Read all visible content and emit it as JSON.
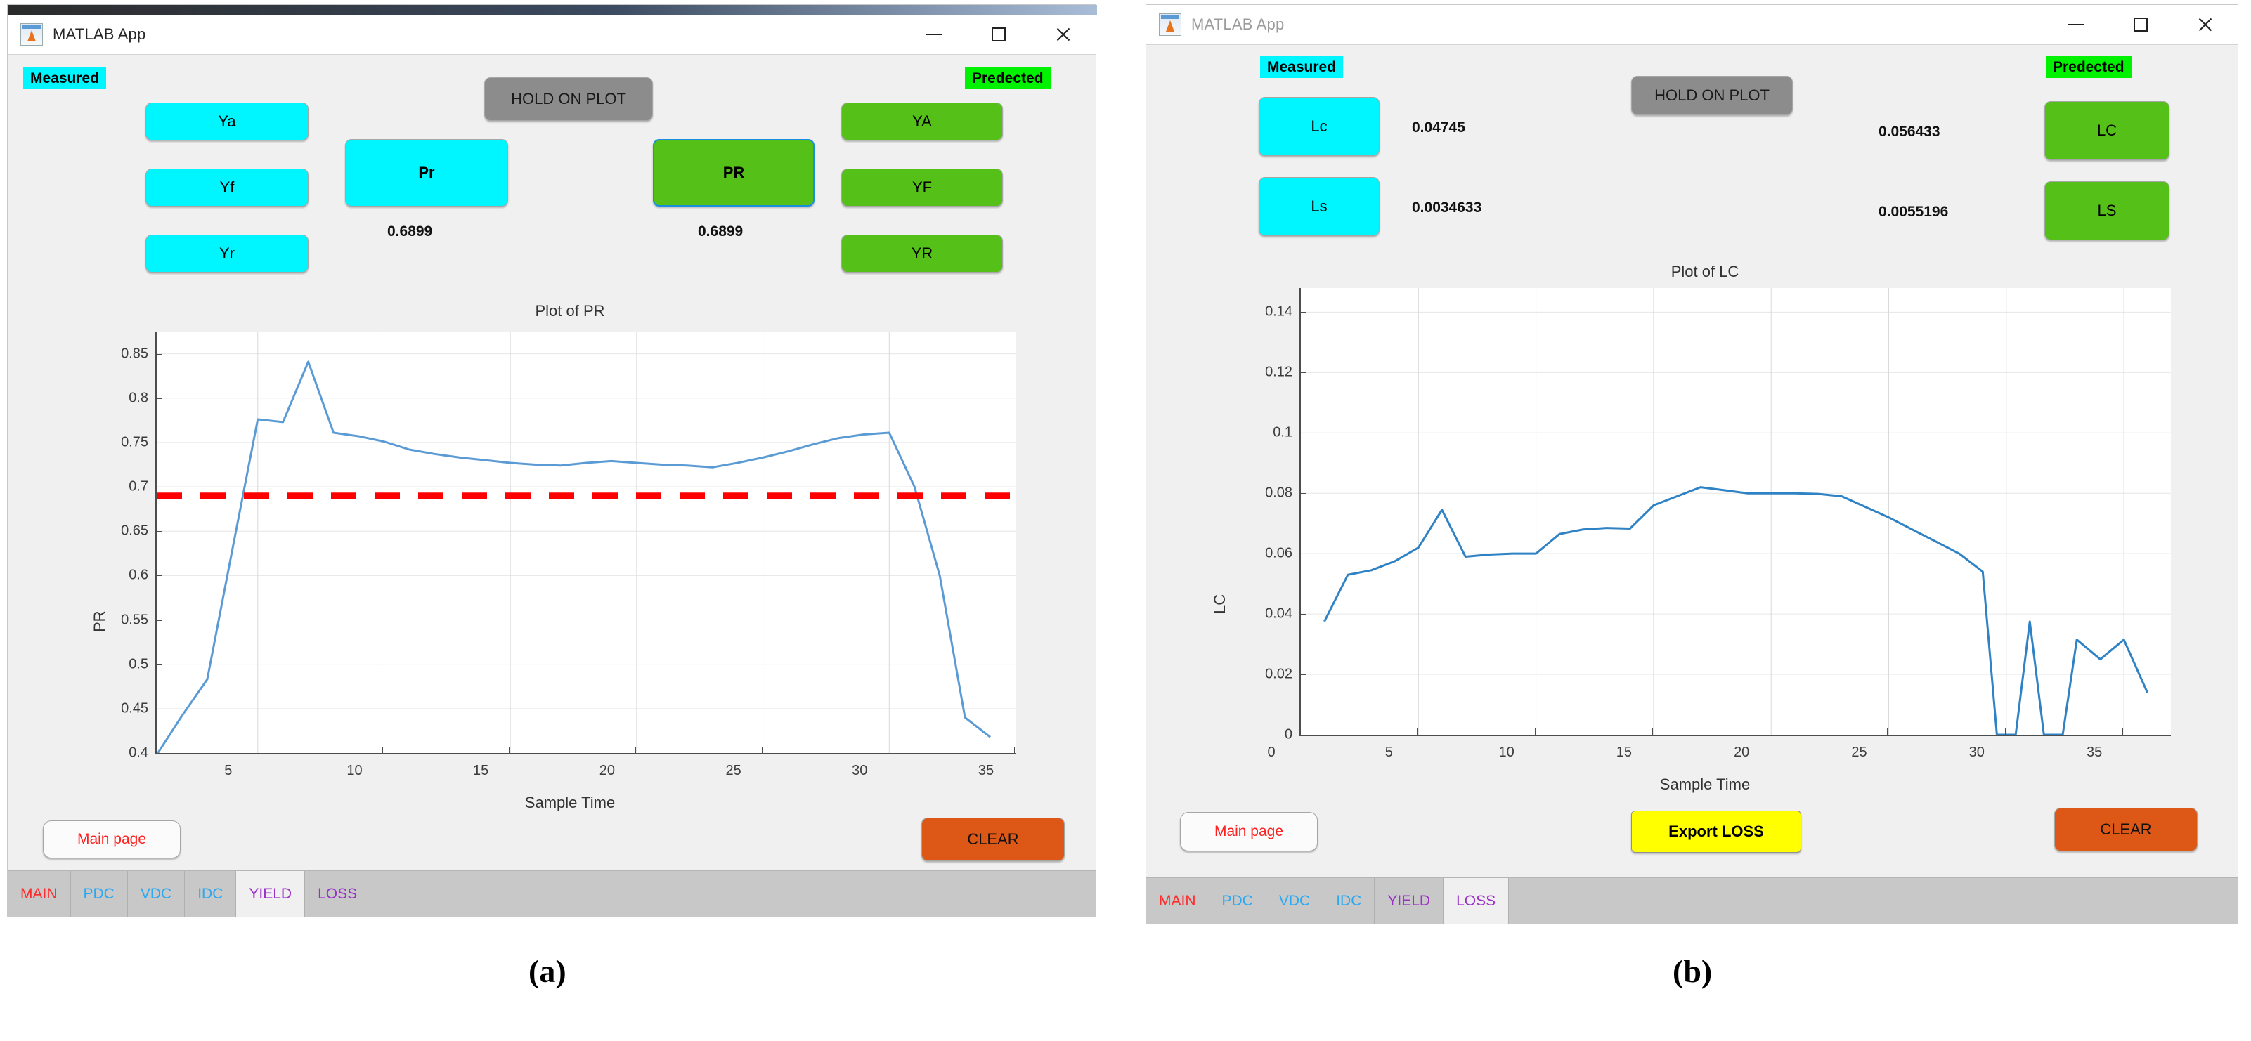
{
  "panel_a": {
    "window": {
      "title": "MATLAB App",
      "icon": "matlab-icon",
      "minimize": "minimize-icon",
      "maximize": "maximize-icon",
      "close": "close-icon"
    },
    "badges": {
      "measured": "Measured",
      "predicted": "Predected"
    },
    "hold_button": "HOLD ON PLOT",
    "measured_buttons": [
      "Ya",
      "Yf",
      "Yr"
    ],
    "predicted_buttons": [
      "YA",
      "YF",
      "YR"
    ],
    "main_measured_button": "Pr",
    "main_predicted_button": "PR",
    "measured_value": "0.6899",
    "predicted_value": "0.6899",
    "main_page_button": "Main page",
    "clear_button": "CLEAR",
    "tabs": [
      {
        "label": "MAIN",
        "color": "#ff2a2a",
        "active": false
      },
      {
        "label": "PDC",
        "color": "#2aa8f2",
        "active": false
      },
      {
        "label": "VDC",
        "color": "#2aa8f2",
        "active": false
      },
      {
        "label": "IDC",
        "color": "#2aa8f2",
        "active": false
      },
      {
        "label": "YIELD",
        "color": "#9b30c8",
        "active": true
      },
      {
        "label": "LOSS",
        "color": "#9b30c8",
        "active": false
      }
    ],
    "caption": "(a)"
  },
  "panel_b": {
    "window": {
      "title": "MATLAB App",
      "icon": "matlab-icon",
      "minimize": "minimize-icon",
      "maximize": "maximize-icon",
      "close": "close-icon"
    },
    "badges": {
      "measured": "Measured",
      "predicted": "Predected"
    },
    "hold_button": "HOLD ON PLOT",
    "measured_buttons": [
      "Lc",
      "Ls"
    ],
    "predicted_buttons": [
      "LC",
      "LS"
    ],
    "measured_values": [
      "0.04745",
      "0.0034633"
    ],
    "predicted_values": [
      "0.056433",
      "0.0055196"
    ],
    "main_page_button": "Main page",
    "export_button": "Export LOSS",
    "clear_button": "CLEAR",
    "tabs": [
      {
        "label": "MAIN",
        "color": "#ff2a2a",
        "active": false
      },
      {
        "label": "PDC",
        "color": "#2aa8f2",
        "active": false
      },
      {
        "label": "VDC",
        "color": "#2aa8f2",
        "active": false
      },
      {
        "label": "IDC",
        "color": "#2aa8f2",
        "active": false
      },
      {
        "label": "YIELD",
        "color": "#9b30c8",
        "active": false
      },
      {
        "label": "LOSS",
        "color": "#9b30c8",
        "active": true
      }
    ],
    "caption": "(b)"
  },
  "chart_data": [
    {
      "id": "plot-pr",
      "type": "line",
      "title": "Plot of PR",
      "xlabel": "Sample Time",
      "ylabel": "PR",
      "xlim": [
        1,
        35
      ],
      "ylim": [
        0.4,
        0.875
      ],
      "xticks": [
        5,
        10,
        15,
        20,
        25,
        30,
        35
      ],
      "yticks": [
        0.4,
        0.45,
        0.5,
        0.55,
        0.6,
        0.65,
        0.7,
        0.75,
        0.8,
        0.85
      ],
      "grid": true,
      "legend": "none",
      "series": [
        {
          "name": "PR",
          "color": "#5b9bd5",
          "style": "solid",
          "x": [
            1,
            2,
            3,
            4,
            5,
            6,
            7,
            8,
            9,
            10,
            11,
            12,
            13,
            14,
            15,
            16,
            17,
            18,
            19,
            20,
            21,
            22,
            23,
            24,
            25,
            26,
            27,
            28,
            29,
            30,
            31,
            32,
            33,
            34
          ],
          "y": [
            0.398,
            0.442,
            0.483,
            0.63,
            0.776,
            0.773,
            0.841,
            0.761,
            0.757,
            0.751,
            0.742,
            0.737,
            0.733,
            0.73,
            0.727,
            0.725,
            0.724,
            0.727,
            0.729,
            0.727,
            0.725,
            0.724,
            0.722,
            0.727,
            0.733,
            0.74,
            0.748,
            0.755,
            0.759,
            0.761,
            0.7,
            0.6,
            0.44,
            0.418
          ]
        },
        {
          "name": "threshold",
          "color": "#ff0000",
          "style": "dashed",
          "value": 0.6899
        }
      ]
    },
    {
      "id": "plot-lc",
      "type": "line",
      "title": "Plot of LC",
      "xlabel": "Sample Time",
      "ylabel": "LC",
      "xlim": [
        0,
        37
      ],
      "ylim": [
        0,
        0.148
      ],
      "xticks": [
        0,
        5,
        10,
        15,
        20,
        25,
        30,
        35
      ],
      "yticks": [
        0,
        0.02,
        0.04,
        0.06,
        0.08,
        0.1,
        0.12,
        0.14
      ],
      "grid": true,
      "legend": "none",
      "series": [
        {
          "name": "LC",
          "color": "#2f82c4",
          "style": "solid",
          "x": [
            1,
            2,
            3,
            4,
            5,
            6,
            7,
            8,
            9,
            10,
            11,
            12,
            13,
            14,
            15,
            16,
            17,
            18,
            19,
            20,
            21,
            22,
            23,
            24,
            25,
            26,
            27,
            28,
            29,
            29.6,
            30.4,
            31,
            31.6,
            32.4,
            33,
            34,
            35,
            36
          ],
          "y": [
            0.0375,
            0.053,
            0.0545,
            0.0575,
            0.062,
            0.0745,
            0.059,
            0.0597,
            0.06,
            0.06,
            0.0665,
            0.068,
            0.0685,
            0.0683,
            0.076,
            0.079,
            0.082,
            0.081,
            0.08,
            0.08,
            0.08,
            0.0798,
            0.079,
            0.0755,
            0.072,
            0.068,
            0.064,
            0.06,
            0.054,
            0.0,
            0.0,
            0.0375,
            0.0,
            0.0,
            0.0315,
            0.025,
            0.0315,
            0.014
          ]
        }
      ]
    }
  ]
}
